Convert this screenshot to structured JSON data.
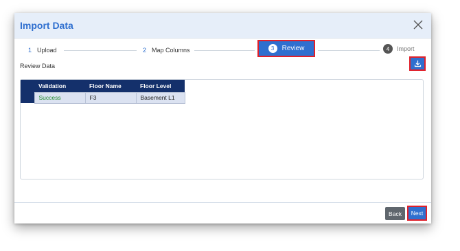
{
  "dialog": {
    "title": "Import Data",
    "close_icon": "close-icon"
  },
  "steps": [
    {
      "number": "1",
      "label": "Upload"
    },
    {
      "number": "2",
      "label": "Map Columns"
    },
    {
      "number": "3",
      "label": "Review"
    },
    {
      "number": "4",
      "label": "Import"
    }
  ],
  "review": {
    "label": "Review Data",
    "download_icon": "download-icon"
  },
  "table": {
    "headers": [
      "Validation",
      "Floor Name",
      "Floor Level"
    ],
    "rows": [
      [
        "Success",
        "F3",
        "Basement L1"
      ]
    ]
  },
  "footer": {
    "back_label": "Back",
    "next_label": "Next"
  },
  "colors": {
    "accent": "#2f6fcf",
    "header_bg": "#e6eef9",
    "table_header": "#14306b",
    "success": "#1f8a2a",
    "highlight": "#e0202a"
  }
}
